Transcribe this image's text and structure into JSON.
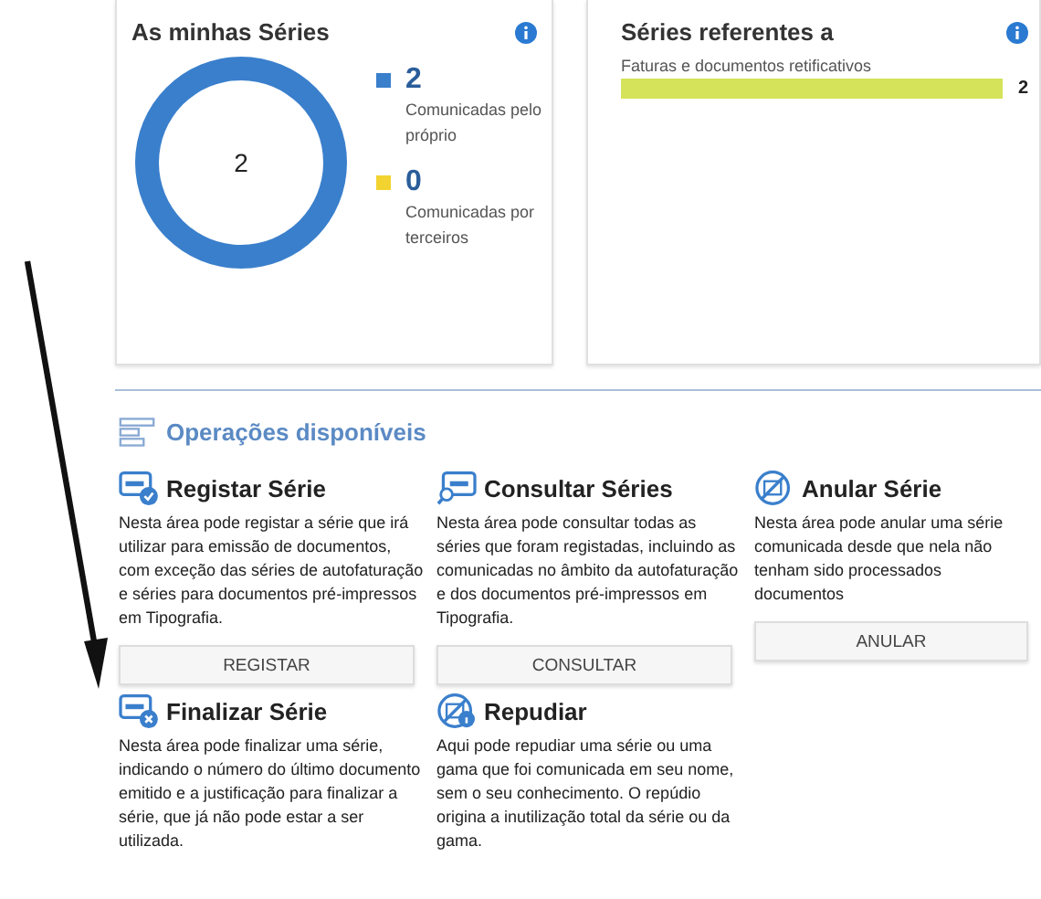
{
  "series_card": {
    "title": "As minhas Séries",
    "total": "2",
    "legend": [
      {
        "value": "2",
        "label": "Comunicadas pelo próprio",
        "color": "#3a7fcc"
      },
      {
        "value": "0",
        "label": "Comunicadas por terceiros",
        "color": "#f2d330"
      }
    ]
  },
  "reference_card": {
    "title": "Séries referentes a",
    "chart_data": {
      "type": "bar",
      "orientation": "horizontal",
      "categories": [
        "Faturas e documentos retificativos"
      ],
      "values": [
        2
      ],
      "data_labels": true
    }
  },
  "operations": {
    "title": "Operações disponíveis",
    "items": [
      {
        "kind": "register",
        "title": "Registar Série",
        "text": "Nesta área pode registar a série que irá utilizar para emissão de documentos, com exceção das séries de autofaturação e séries para documentos pré-impressos em Tipografia.",
        "button": "REGISTAR"
      },
      {
        "kind": "consult",
        "title": "Consultar Séries",
        "text": "Nesta área pode consultar todas as séries que foram registadas, incluindo as comunicadas no âmbito da autofaturação e dos documentos pré-impressos em Tipografia.",
        "button": "CONSULTAR"
      },
      {
        "kind": "cancel",
        "title": "Anular Série",
        "text": "Nesta área pode anular uma série comunicada desde que nela não tenham sido processados documentos",
        "button": "ANULAR"
      },
      {
        "kind": "finish",
        "title": "Finalizar Série",
        "text": "Nesta área pode finalizar uma série, indicando o número do último documento emitido e a justificação para finalizar a série, que já não pode estar a ser utilizada."
      },
      {
        "kind": "repudiate",
        "title": "Repudiar",
        "text": "Aqui pode repudiar uma série ou uma gama que foi comunicada em seu nome, sem o seu conhecimento. O repúdio origina a inutilização total da série ou da gama."
      }
    ]
  }
}
